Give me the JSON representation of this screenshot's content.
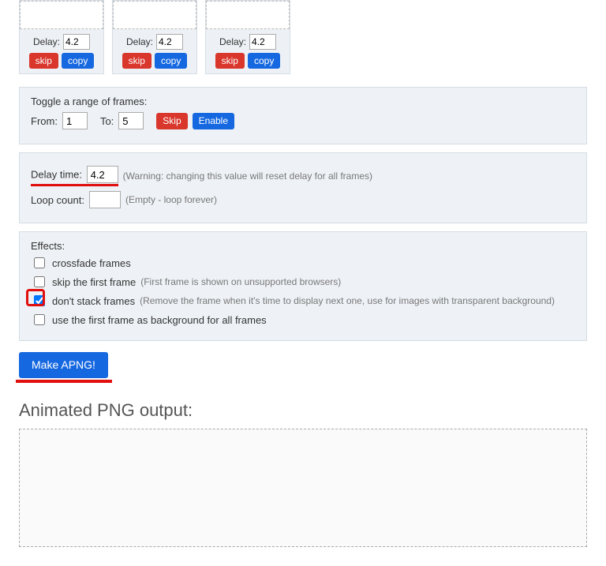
{
  "frames": [
    {
      "delay_label": "Delay:",
      "delay_value": "4.2",
      "skip_label": "skip",
      "copy_label": "copy"
    },
    {
      "delay_label": "Delay:",
      "delay_value": "4.2",
      "skip_label": "skip",
      "copy_label": "copy"
    },
    {
      "delay_label": "Delay:",
      "delay_value": "4.2",
      "skip_label": "skip",
      "copy_label": "copy"
    }
  ],
  "toggle_range": {
    "title": "Toggle a range of frames:",
    "from_label": "From:",
    "from_value": "1",
    "to_label": "To:",
    "to_value": "5",
    "skip_label": "Skip",
    "enable_label": "Enable"
  },
  "delay_loop": {
    "delay_label": "Delay time:",
    "delay_value": "4.2",
    "delay_hint": "(Warning: changing this value will reset delay for all frames)",
    "loop_label": "Loop count:",
    "loop_value": "",
    "loop_hint": "(Empty - loop forever)"
  },
  "effects": {
    "title": "Effects:",
    "crossfade": {
      "checked": false,
      "label": "crossfade frames"
    },
    "skip_first": {
      "checked": false,
      "label": "skip the first frame",
      "hint": "(First frame is shown on unsupported browsers)"
    },
    "dont_stack": {
      "checked": true,
      "label": "don't stack frames",
      "hint": "(Remove the frame when it's time to display next one, use for images with transparent background)"
    },
    "use_first_bg": {
      "checked": false,
      "label": "use the first frame as background for all frames"
    }
  },
  "make_button": "Make APNG!",
  "output_heading": "Animated PNG output:"
}
